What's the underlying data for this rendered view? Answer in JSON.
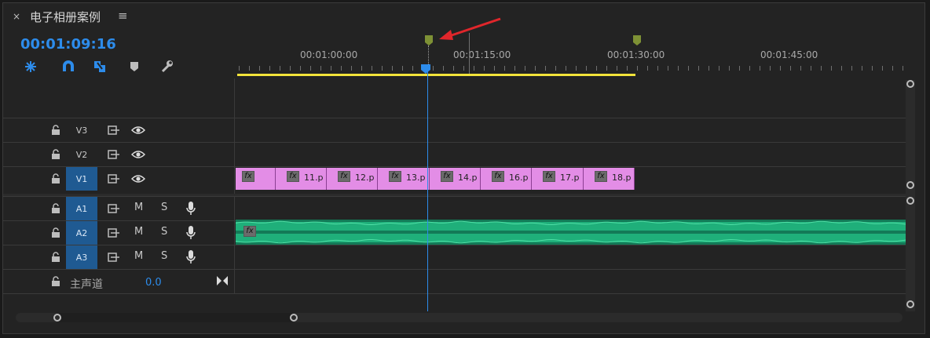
{
  "header": {
    "close_icon": "×",
    "title": "电子相册案例",
    "menu_icon": "≡"
  },
  "timecode": "00:01:09:16",
  "toolbar": {
    "items": [
      {
        "name": "nest-tool-icon",
        "glyph": "✱"
      },
      {
        "name": "snap-magnet-icon",
        "glyph": "∩"
      },
      {
        "name": "linked-selection-icon",
        "glyph": "⟐"
      },
      {
        "name": "add-marker-icon",
        "glyph": "⬟"
      },
      {
        "name": "settings-wrench-icon",
        "glyph": "🔧"
      }
    ]
  },
  "ruler": {
    "labels": [
      "00:01:00:00",
      "00:01:15:00",
      "00:01:30:00",
      "00:01:45:00"
    ]
  },
  "tracks": {
    "video": [
      {
        "name": "V3",
        "active": false
      },
      {
        "name": "V2",
        "active": false
      },
      {
        "name": "V1",
        "active": true
      }
    ],
    "audio": [
      {
        "name": "A1",
        "active": true,
        "m": "M",
        "s": "S"
      },
      {
        "name": "A2",
        "active": true,
        "m": "M",
        "s": "S"
      },
      {
        "name": "A3",
        "active": true,
        "m": "M",
        "s": "S"
      }
    ],
    "master": {
      "label": "主声道",
      "value": "0.0"
    }
  },
  "clips": [
    {
      "fx": "fx",
      "label": ""
    },
    {
      "fx": "fx",
      "label": "11.p"
    },
    {
      "fx": "fx",
      "label": "12.p"
    },
    {
      "fx": "fx",
      "label": "13.p"
    },
    {
      "fx": "fx",
      "label": "14.p"
    },
    {
      "fx": "fx",
      "label": "16.p"
    },
    {
      "fx": "fx",
      "label": "17.p"
    },
    {
      "fx": "fx",
      "label": "18.p"
    }
  ],
  "audio_clip": {
    "fx": "fx"
  },
  "colors": {
    "accent": "#2d8ceb",
    "clip": "#e38de6",
    "audio": "#1faf7a",
    "workarea": "#f2e33a",
    "marker": "#7e9135",
    "arrow": "#e0262b"
  }
}
